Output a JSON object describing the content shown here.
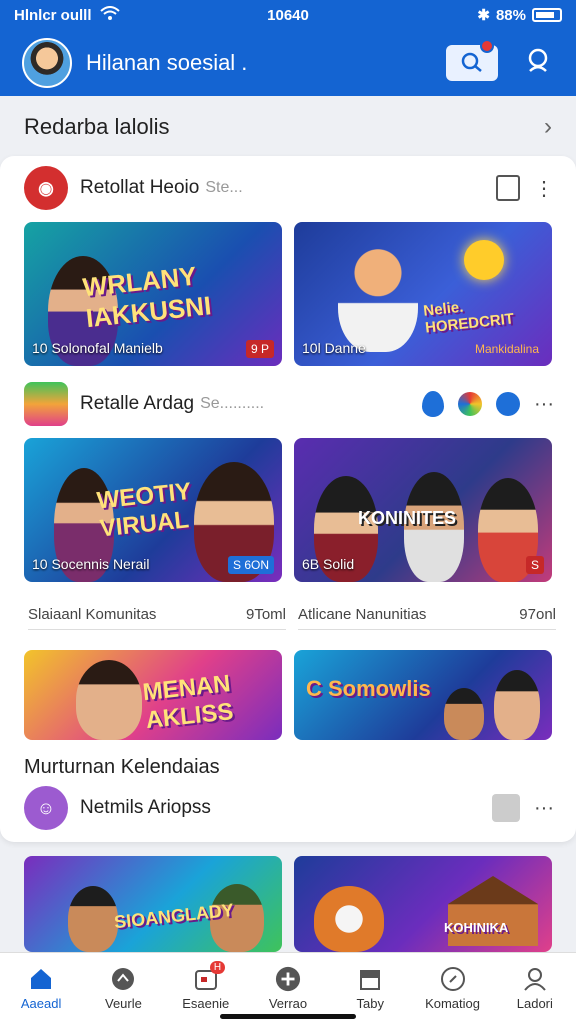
{
  "status": {
    "carrier": "Hlnlcr oulll",
    "time": "10640",
    "battery": "88%"
  },
  "app": {
    "title": "Hilanan soesial ."
  },
  "section": {
    "title": "Redarba lalolis"
  },
  "groups": [
    {
      "name": "Retollat Heoio",
      "sub": "Ste...",
      "color": "#d32f2f"
    },
    {
      "name": "Retalle Ardag",
      "sub": "Se..........",
      "color": "#f2a43a"
    },
    {
      "name": "Netmils Ariopss",
      "sub": "",
      "color": "#9c5bd0"
    }
  ],
  "thumbs": [
    {
      "headline": "WRLANY IAKKUSNI",
      "caption": "10 Solonofal Manielb",
      "badge": "9 P"
    },
    {
      "headline": "Nelie. HOREDCRIT",
      "caption": "10l Danne",
      "badge": "Mankidalina"
    },
    {
      "headline": "WEOTIY VIRUAL",
      "caption": "10 Socennis Nerail",
      "badge": "S 6ON"
    },
    {
      "headline": "KONINITES",
      "caption": "6B Solid",
      "badge": "S"
    },
    {
      "headline": "MENAN AKLISS",
      "caption": "",
      "badge": ""
    },
    {
      "headline": "C Somowlis",
      "caption": "",
      "badge": ""
    },
    {
      "headline": "SIOANGLADY",
      "caption": "",
      "badge": ""
    },
    {
      "headline": "KOHINIKA",
      "caption": "",
      "badge": ""
    }
  ],
  "meta": [
    {
      "label": "Slaiaanl Komunitas",
      "count": "9Toml"
    },
    {
      "label": "Atlicane Nanunitias",
      "count": "97onl"
    }
  ],
  "label_line": "Murturnan Kelendaias",
  "nav": [
    {
      "label": "Aaeadl",
      "icon": "home-icon"
    },
    {
      "label": "Veurle",
      "icon": "explore-icon"
    },
    {
      "label": "Esaenie",
      "icon": "calendar-icon",
      "badge": "H"
    },
    {
      "label": "Verrao",
      "icon": "add-icon"
    },
    {
      "label": "Taby",
      "icon": "store-icon"
    },
    {
      "label": "Komatiog",
      "icon": "compass-icon"
    },
    {
      "label": "Ladori",
      "icon": "profile-icon"
    }
  ],
  "colors": {
    "brand": "#1464d2",
    "accent": "#e53935"
  }
}
